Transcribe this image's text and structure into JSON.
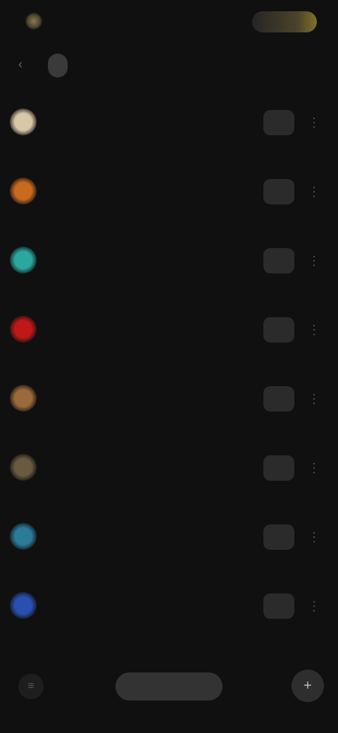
{
  "header": {
    "top_left_icon": "app-icon",
    "top_right_label": "",
    "back_icon": "back-icon",
    "title": ""
  },
  "rows": [
    {
      "title": "",
      "subtitle": "",
      "avatar_color": "#d8c8a8"
    },
    {
      "title": "",
      "subtitle": "",
      "avatar_color": "#c86a20"
    },
    {
      "title": "",
      "subtitle": "",
      "avatar_color": "#2aa8a0"
    },
    {
      "title": "",
      "subtitle": "",
      "avatar_color": "#c01818"
    },
    {
      "title": "",
      "subtitle": "",
      "avatar_color": "#9a6a3a"
    },
    {
      "title": "",
      "subtitle": "",
      "avatar_color": "#6a5a40"
    },
    {
      "title": "",
      "subtitle": "",
      "avatar_color": "#2a7a98"
    },
    {
      "title": "",
      "subtitle": "",
      "avatar_color": "#2850b0"
    }
  ],
  "footer": {
    "left_icon": "menu-icon",
    "center_label": "",
    "right_icon": "plus-icon"
  }
}
